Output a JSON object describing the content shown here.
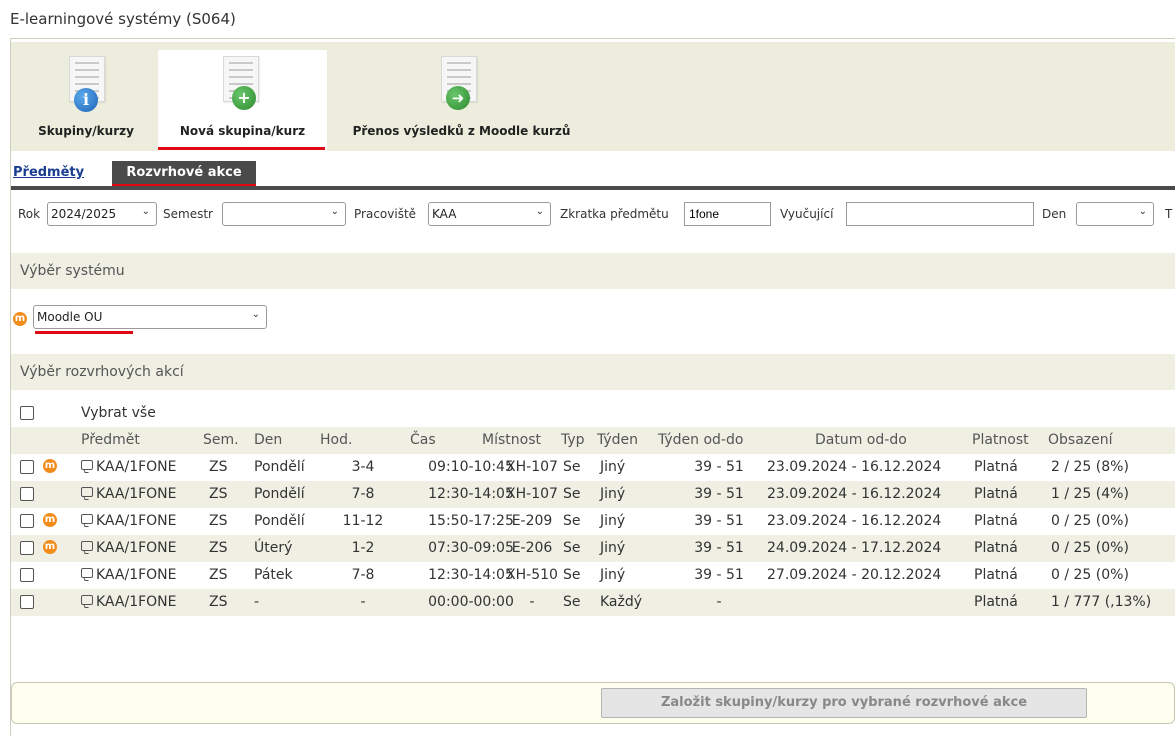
{
  "app": {
    "title": "E-learningové systémy (S064)"
  },
  "toolbar": {
    "items": [
      {
        "label": "Skupiny/kurzy",
        "icon": "info-document-icon"
      },
      {
        "label": "Nová skupina/kurz",
        "icon": "add-document-icon"
      },
      {
        "label": "Přenos výsledků z Moodle kurzů",
        "icon": "transfer-document-icon"
      }
    ]
  },
  "tabs": {
    "subjects": "Předměty",
    "schedule": "Rozvrhové akce"
  },
  "filters": {
    "year_label": "Rok",
    "year_value": "2024/2025",
    "semester_label": "Semestr",
    "semester_value": "",
    "workplace_label": "Pracoviště",
    "workplace_value": "KAA",
    "course_code_label": "Zkratka předmětu",
    "course_code_value": "1fone",
    "teacher_label": "Vyučující",
    "teacher_value": "",
    "day_label": "Den",
    "day_value": "",
    "cut_label": "T"
  },
  "system_section": {
    "title": "Výběr systému",
    "selected": "Moodle OU"
  },
  "actions_section": {
    "title": "Výběr rozvrhových akcí"
  },
  "table": {
    "select_all": "Vybrat vše",
    "headers": [
      "Předmět",
      "Sem.",
      "Den",
      "Hod.",
      "Čas",
      "Místnost",
      "Typ",
      "Týden",
      "Týden od-do",
      "Datum od-do",
      "Platnost",
      "Obsazení"
    ],
    "rows": [
      {
        "moodle": true,
        "subject": "KAA/1FONE",
        "sem": "ZS",
        "day": "Pondělí",
        "hours": "3-4",
        "time": "09:10-10:45",
        "room": "XH-107",
        "type": "Se",
        "week": "Jiný",
        "weeks": "39 - 51",
        "dates": "23.09.2024 - 16.12.2024",
        "validity": "Platná",
        "occupancy": "2 / 25 (8%)"
      },
      {
        "moodle": false,
        "subject": "KAA/1FONE",
        "sem": "ZS",
        "day": "Pondělí",
        "hours": "7-8",
        "time": "12:30-14:05",
        "room": "XH-107",
        "type": "Se",
        "week": "Jiný",
        "weeks": "39 - 51",
        "dates": "23.09.2024 - 16.12.2024",
        "validity": "Platná",
        "occupancy": "1 / 25 (4%)"
      },
      {
        "moodle": true,
        "subject": "KAA/1FONE",
        "sem": "ZS",
        "day": "Pondělí",
        "hours": "11-12",
        "time": "15:50-17:25",
        "room": "E-209",
        "type": "Se",
        "week": "Jiný",
        "weeks": "39 - 51",
        "dates": "23.09.2024 - 16.12.2024",
        "validity": "Platná",
        "occupancy": "0 / 25 (0%)"
      },
      {
        "moodle": true,
        "subject": "KAA/1FONE",
        "sem": "ZS",
        "day": "Úterý",
        "hours": "1-2",
        "time": "07:30-09:05",
        "room": "E-206",
        "type": "Se",
        "week": "Jiný",
        "weeks": "39 - 51",
        "dates": "24.09.2024 - 17.12.2024",
        "validity": "Platná",
        "occupancy": "0 / 25 (0%)"
      },
      {
        "moodle": false,
        "subject": "KAA/1FONE",
        "sem": "ZS",
        "day": "Pátek",
        "hours": "7-8",
        "time": "12:30-14:05",
        "room": "XH-510",
        "type": "Se",
        "week": "Jiný",
        "weeks": "39 - 51",
        "dates": "27.09.2024 - 20.12.2024",
        "validity": "Platná",
        "occupancy": "0 / 25 (0%)"
      },
      {
        "moodle": false,
        "subject": "KAA/1FONE",
        "sem": "ZS",
        "day": "-",
        "hours": "-",
        "time": "00:00-00:00",
        "room": "-",
        "type": "Se",
        "week": "Každý",
        "weeks": "-",
        "dates": "",
        "validity": "Platná",
        "occupancy": "1 / 777 (,13%)"
      }
    ]
  },
  "footer": {
    "submit_label": "Založit skupiny/kurzy pro vybrané rozvrhové akce"
  },
  "colors": {
    "accent_red": "#e30613",
    "moodle_orange": "#f28c1b",
    "tab_dark": "#4a4a4a",
    "toolbar_bg": "#ededde"
  }
}
